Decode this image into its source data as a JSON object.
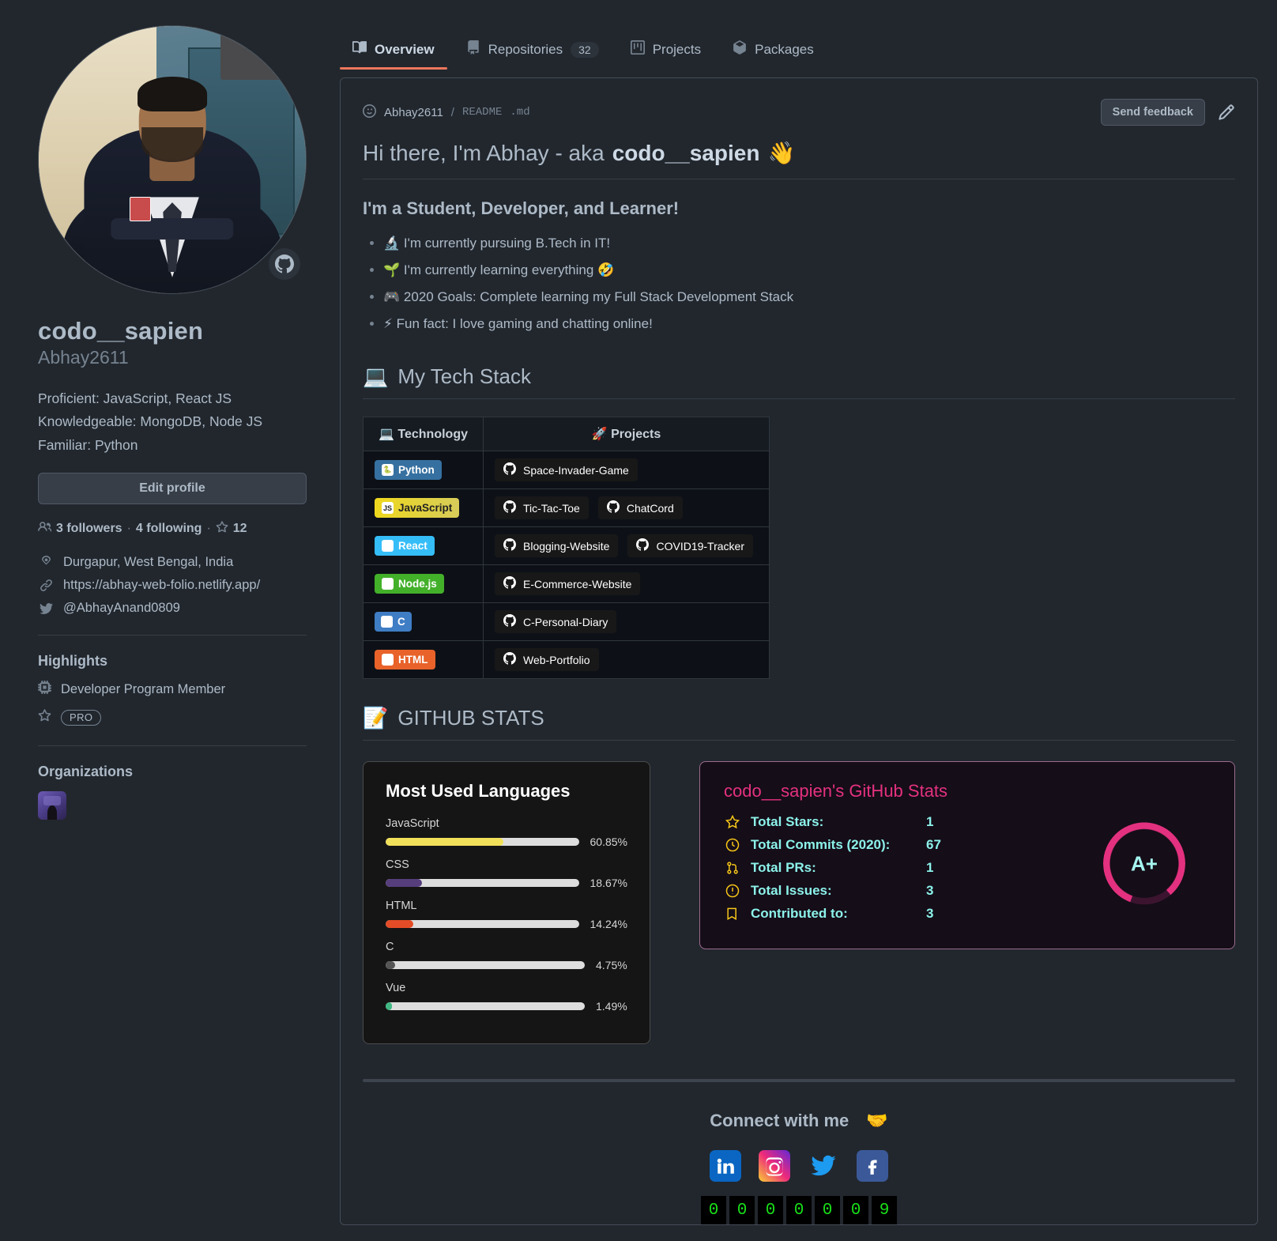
{
  "tabs": [
    {
      "label": "Overview",
      "icon": "book-icon",
      "active": true,
      "count": null
    },
    {
      "label": "Repositories",
      "icon": "repo-icon",
      "active": false,
      "count": "32"
    },
    {
      "label": "Projects",
      "icon": "project-icon",
      "active": false,
      "count": null
    },
    {
      "label": "Packages",
      "icon": "package-icon",
      "active": false,
      "count": null
    }
  ],
  "profile": {
    "name": "codo__sapien",
    "login": "Abhay2611",
    "bio_lines": [
      "Proficient: JavaScript, React JS",
      "Knowledgeable: MongoDB, Node JS",
      "Familiar:  Python"
    ],
    "edit_button": "Edit profile",
    "followers": "3 followers",
    "separator1": "·",
    "following": "4 following",
    "separator2": "·",
    "stars": "12",
    "location": "Durgapur, West Bengal, India",
    "website": "https://abhay-web-folio.netlify.app/",
    "twitter": "@AbhayAnand0809",
    "highlights_title": "Highlights",
    "highlight_developer": "Developer Program Member",
    "highlight_pro": "PRO",
    "organizations_title": "Organizations"
  },
  "readme": {
    "owner": "Abhay2611",
    "slash": "/",
    "file": "README",
    "ext": ".md",
    "send_feedback": "Send feedback",
    "heading_prefix": "Hi there, I'm Abhay - aka ",
    "heading_strong": "codo__sapien",
    "heading_emoji": "👋",
    "subheading": "I'm a Student, Developer, and Learner!",
    "bullets": [
      {
        "emoji": "🔬",
        "text": "I'm currently pursuing B.Tech in IT!"
      },
      {
        "emoji": "🌱",
        "text": "I'm currently learning everything 🤣"
      },
      {
        "emoji": "🎮",
        "text": "2020 Goals: Complete learning my Full Stack Development Stack"
      },
      {
        "emoji": "⚡",
        "text": "Fun fact: I love gaming and chatting online!"
      }
    ],
    "tech_stack_emoji": "💻",
    "tech_stack_title": "My Tech Stack",
    "github_stats_emoji": "📝",
    "github_stats_title": "GITHUB STATS"
  },
  "tech_table": {
    "col1_emoji": "💻",
    "col1_label": "Technology",
    "col2_emoji": "🚀",
    "col2_label": "Projects",
    "rows": [
      {
        "tech": "Python",
        "tech_class": "python",
        "glyph": "🐍",
        "projects": [
          "Space-Invader-Game"
        ]
      },
      {
        "tech": "JavaScript",
        "tech_class": "js",
        "glyph": "JS",
        "projects": [
          "Tic-Tac-Toe",
          "ChatCord"
        ]
      },
      {
        "tech": "React",
        "tech_class": "react",
        "glyph": "⚛",
        "projects": [
          "Blogging-Website",
          "COVID19-Tracker"
        ]
      },
      {
        "tech": "Node.js",
        "tech_class": "node",
        "glyph": "JS",
        "projects": [
          "E-Commerce-Website"
        ]
      },
      {
        "tech": "C",
        "tech_class": "clang",
        "glyph": "C",
        "projects": [
          "C-Personal-Diary"
        ]
      },
      {
        "tech": "HTML",
        "tech_class": "html",
        "glyph": "5",
        "projects": [
          "Web-Portfolio"
        ]
      }
    ]
  },
  "chart_data": {
    "type": "bar",
    "title": "Most Used Languages",
    "orientation": "horizontal",
    "categories": [
      "JavaScript",
      "CSS",
      "HTML",
      "C",
      "Vue"
    ],
    "values": [
      60.85,
      18.67,
      14.24,
      4.75,
      1.49
    ],
    "value_labels": [
      "60.85%",
      "18.67%",
      "14.24%",
      "4.75%",
      "1.49%"
    ],
    "colors": [
      "#f1e05a",
      "#563d7c",
      "#e34c26",
      "#555555",
      "#41b883"
    ],
    "xlabel": "",
    "ylabel": "",
    "xlim": [
      0,
      100
    ],
    "grid": false,
    "legend": "none"
  },
  "stats_card": {
    "title": "codo__sapien's GitHub Stats",
    "grade": "A+",
    "rows": [
      {
        "icon": "star-icon",
        "label": "Total Stars:",
        "value": "1"
      },
      {
        "icon": "clock-icon",
        "label": "Total Commits (2020):",
        "value": "67"
      },
      {
        "icon": "pull-request-icon",
        "label": "Total PRs:",
        "value": "1"
      },
      {
        "icon": "issue-icon",
        "label": "Total Issues:",
        "value": "3"
      },
      {
        "icon": "repo-icon",
        "label": "Contributed to:",
        "value": "3"
      }
    ]
  },
  "footer": {
    "connect_text": "Connect with me",
    "connect_emoji": "🤝",
    "socials": [
      "linkedin-icon",
      "instagram-icon",
      "twitter-icon",
      "facebook-icon"
    ],
    "visitor_digits": [
      "0",
      "0",
      "0",
      "0",
      "0",
      "0",
      "9"
    ]
  },
  "colors": {
    "accent": "#ec775c",
    "page_bg": "#22272e",
    "card_bg": "#0d1117",
    "stats_pink": "#e4317f",
    "stats_cyan": "#8cf2ea",
    "counter_green": "#19e019"
  }
}
